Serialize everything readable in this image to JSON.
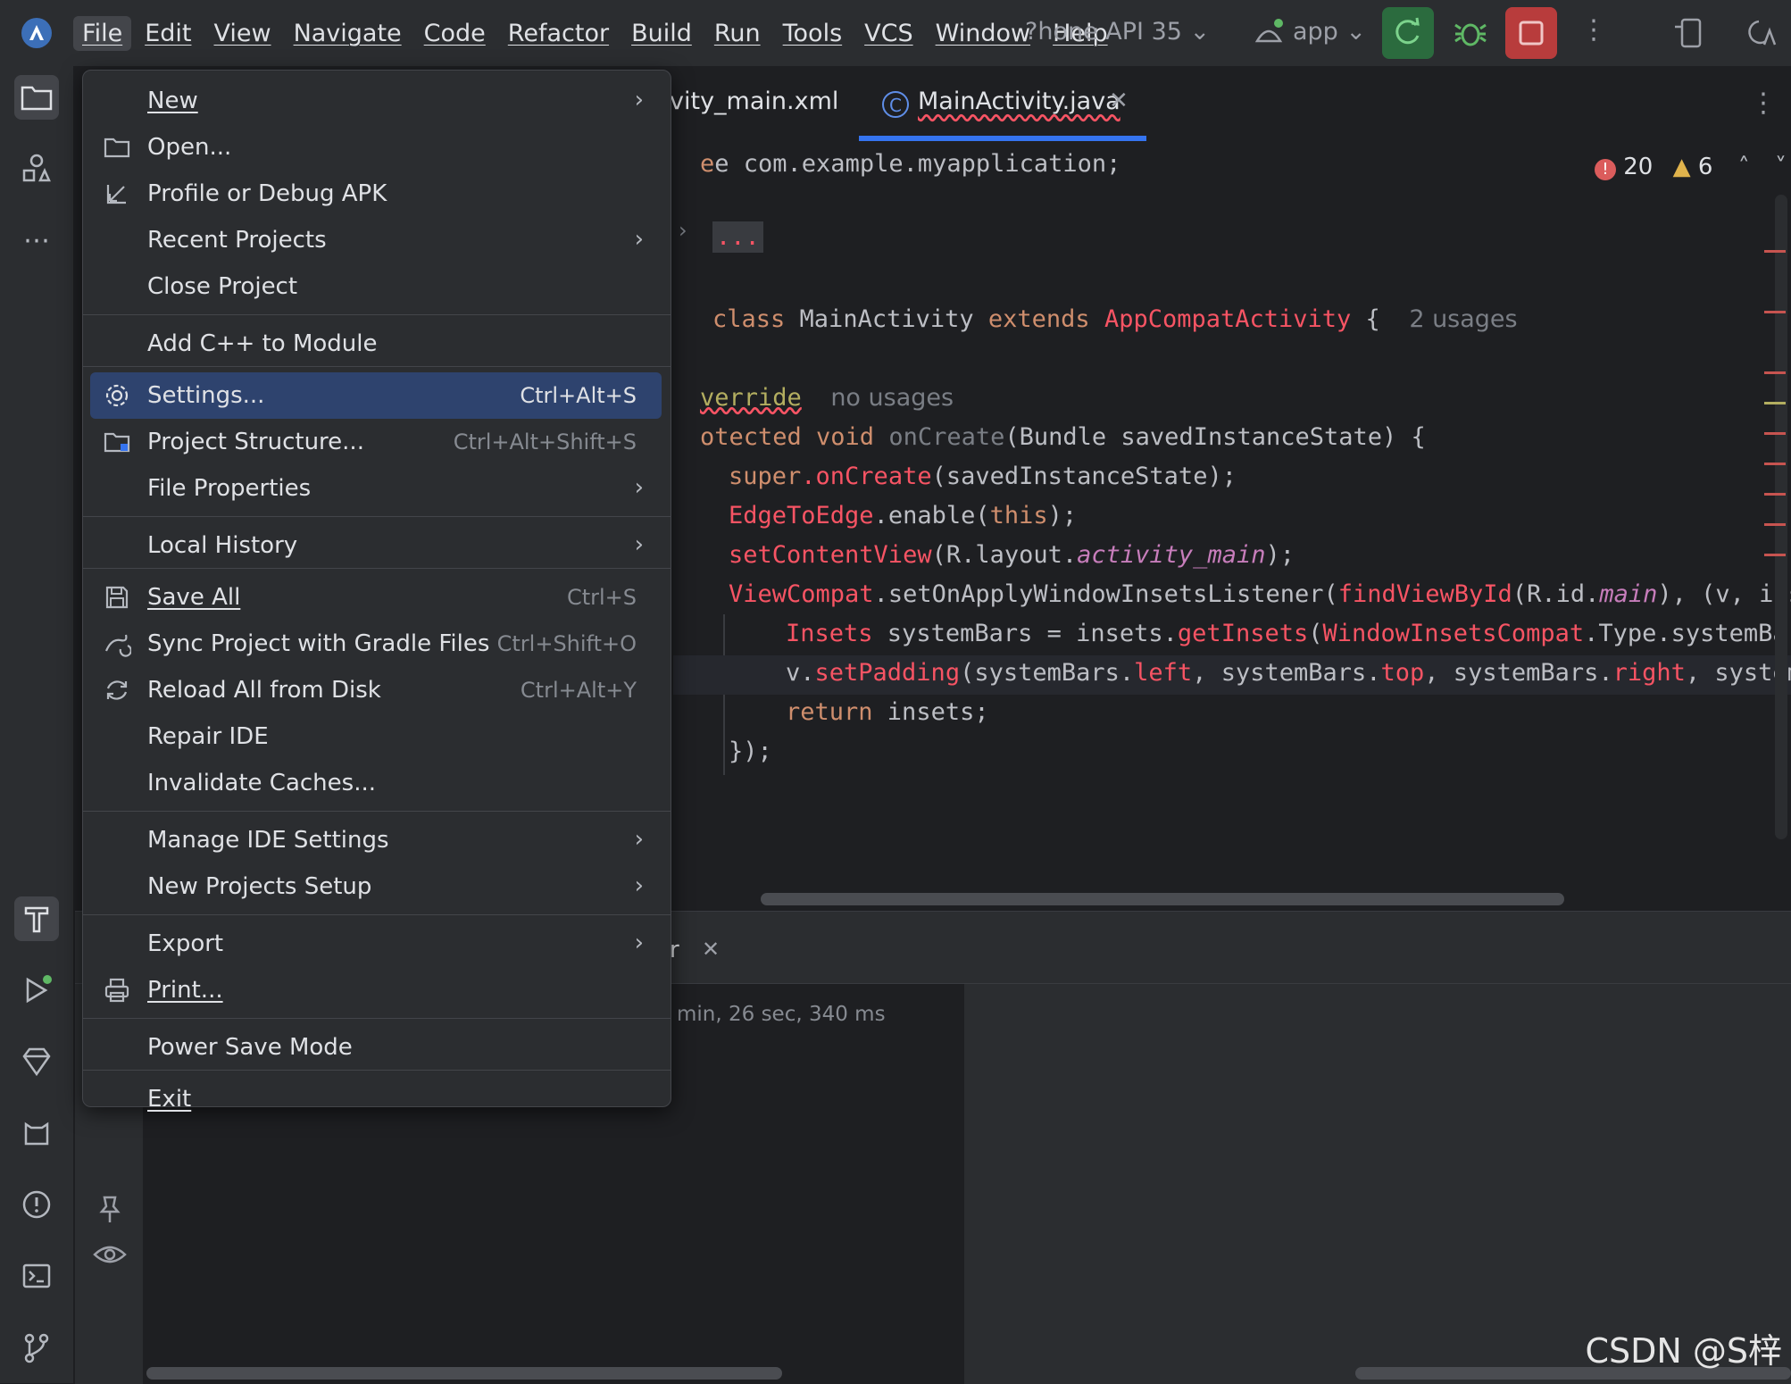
{
  "menubar": {
    "items": [
      "File",
      "Edit",
      "View",
      "Navigate",
      "Code",
      "Refactor",
      "Build",
      "Run",
      "Tools",
      "VCS",
      "Window",
      "Help"
    ],
    "device": "?hone API 35",
    "run_config": "app"
  },
  "tabs": [
    {
      "label": "vity_main.xml"
    },
    {
      "label": "MainActivity.java"
    }
  ],
  "editor": {
    "errors": "20",
    "warnings": "6",
    "lines": {
      "l1": "e com.example.myapplication;",
      "l2": "...",
      "class_decl_prefix": "class ",
      "class_name": "MainActivity",
      "extends_kw": " extends ",
      "super_class": "AppCompatActivity",
      "brace": " {",
      "usages": "2 usages",
      "override": "verride",
      "no_usages": "no usages",
      "oncreate_kw": "otected void ",
      "oncreate_fn": "onCreate",
      "oncreate_args": "(Bundle savedInstanceState) {",
      "super_kw": "super",
      "super_call": ".onCreate",
      "super_args": "(savedInstanceState);",
      "edge": "EdgeToEdge",
      "edge_call": ".enable(",
      "edge_this": "this",
      "edge_end": ");",
      "setcv": "setContentView",
      "setcv_args": "(R.layout.",
      "setcv_ital": "activity_main",
      "setcv_end": ");",
      "vc": "ViewCompat",
      "vc_call": ".setOnApplyWindowInsetsListener(",
      "vc_find": "findViewById",
      "vc_args": "(R.id.",
      "vc_ital": "main",
      "vc_end": "), (v, ins",
      "ins_type": "Insets",
      "ins_mid": " systemBars = insets.",
      "ins_get": "getInsets",
      "ins_paren": "(",
      "ins_wic": "WindowInsetsCompat",
      "ins_end": ".Type.systemBars",
      "pad_v": "v.",
      "pad_fn": "setPadding",
      "pad_a": "(systemBars.",
      "pad_left": "left",
      "pad_b": ", systemBars.",
      "pad_top": "top",
      "pad_c": ", systemBars.",
      "pad_right": "right",
      "pad_d": ", system",
      "ret_kw": "return",
      "ret_rest": " insets;",
      "close": "});"
    }
  },
  "bottom_panel": {
    "tab_fragment": "r",
    "build_time": "min, 26 sec, 340 ms"
  },
  "file_menu": {
    "items": [
      {
        "label": "New",
        "shortcut": "",
        "submenu": true
      },
      {
        "label": "Open...",
        "shortcut": "",
        "submenu": false
      },
      {
        "label": "Profile or Debug APK",
        "shortcut": "",
        "submenu": false
      },
      {
        "label": "Recent Projects",
        "shortcut": "",
        "submenu": true
      },
      {
        "label": "Close Project",
        "shortcut": "",
        "submenu": false
      },
      {
        "label": "Add C++ to Module",
        "shortcut": "",
        "submenu": false
      },
      {
        "label": "Settings...",
        "shortcut": "Ctrl+Alt+S",
        "submenu": false
      },
      {
        "label": "Project Structure...",
        "shortcut": "Ctrl+Alt+Shift+S",
        "submenu": false
      },
      {
        "label": "File Properties",
        "shortcut": "",
        "submenu": true
      },
      {
        "label": "Local History",
        "shortcut": "",
        "submenu": true
      },
      {
        "label": "Save All",
        "shortcut": "Ctrl+S",
        "submenu": false
      },
      {
        "label": "Sync Project with Gradle Files",
        "shortcut": "Ctrl+Shift+O",
        "submenu": false
      },
      {
        "label": "Reload All from Disk",
        "shortcut": "Ctrl+Alt+Y",
        "submenu": false
      },
      {
        "label": "Repair IDE",
        "shortcut": "",
        "submenu": false
      },
      {
        "label": "Invalidate Caches...",
        "shortcut": "",
        "submenu": false
      },
      {
        "label": "Manage IDE Settings",
        "shortcut": "",
        "submenu": true
      },
      {
        "label": "New Projects Setup",
        "shortcut": "",
        "submenu": true
      },
      {
        "label": "Export",
        "shortcut": "",
        "submenu": true
      },
      {
        "label": "Print...",
        "shortcut": "",
        "submenu": false
      },
      {
        "label": "Power Save Mode",
        "shortcut": "",
        "submenu": false
      },
      {
        "label": "Exit",
        "shortcut": "",
        "submenu": false
      }
    ],
    "selected": "Settings...",
    "arrow": "›"
  },
  "watermark": "CSDN @S梓",
  "colors": {
    "selection": "#2e436e",
    "accent": "#3574f0",
    "error": "#c75450"
  }
}
